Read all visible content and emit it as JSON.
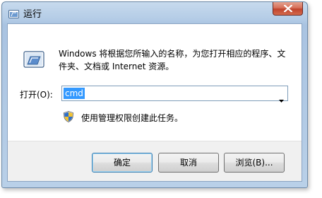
{
  "window": {
    "title": "运行",
    "close_label": "×"
  },
  "icons": {
    "title": "run-icon",
    "main": "run-dialog-icon",
    "admin": "uac-shield-icon",
    "combo": "chevron-down-icon"
  },
  "description": "Windows 将根据您所输入的名称，为您打开相应的程序、文件夹、文档或 Internet 资源。",
  "open_field": {
    "label": "打开(O):",
    "value": "cmd"
  },
  "admin_notice": "使用管理权限创建此任务。",
  "buttons": {
    "ok": "确定",
    "cancel": "取消",
    "browse": "浏览(B)..."
  },
  "colors": {
    "selection": "#3399ff",
    "close_button": "#c0432d"
  }
}
